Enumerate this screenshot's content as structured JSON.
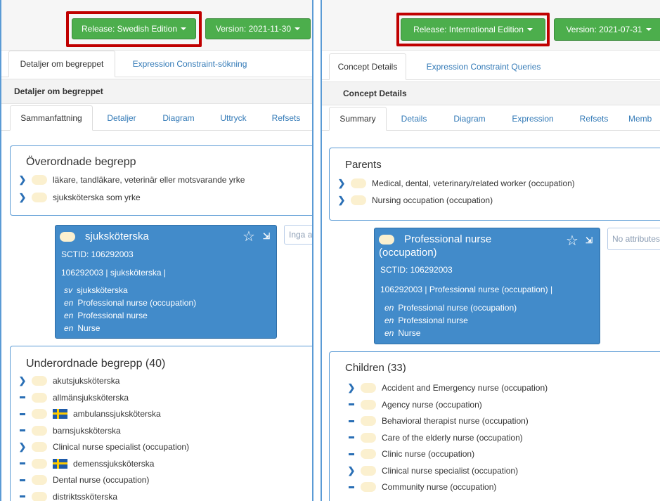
{
  "left": {
    "release_label": "Release: Swedish Edition",
    "version_label": "Version: 2021-11-30",
    "tabs": [
      "Detaljer om begreppet",
      "Expression Constraint-sökning"
    ],
    "section_title": "Detaljer om begreppet",
    "subtabs": [
      "Sammanfattning",
      "Detaljer",
      "Diagram",
      "Uttryck",
      "Refsets"
    ],
    "parents": {
      "title": "Överordnade begrepp",
      "items": [
        "läkare, tandläkare, veterinär eller motsvarande yrke",
        "sjuksköterska som yrke"
      ]
    },
    "concept": {
      "title": "sjuksköterska",
      "sctid": "SCTID: 106292003",
      "fsn": "106292003 | sjuksköterska |",
      "synonyms": [
        {
          "lang": "sv",
          "term": "sjuksköterska"
        },
        {
          "lang": "en",
          "term": "Professional nurse (occupation)"
        },
        {
          "lang": "en",
          "term": "Professional nurse"
        },
        {
          "lang": "en",
          "term": "Nurse"
        }
      ],
      "attributes": "Inga a"
    },
    "children": {
      "title": "Underordnade begrepp (40)",
      "items": [
        {
          "label": "akutsjuksköterska",
          "icon": "chevron",
          "flag": false
        },
        {
          "label": "allmänsjuksköterska",
          "icon": "dash",
          "flag": false
        },
        {
          "label": "ambulanssjuksköterska",
          "icon": "dash",
          "flag": true
        },
        {
          "label": "barnsjuksköterska",
          "icon": "dash",
          "flag": false
        },
        {
          "label": "Clinical nurse specialist (occupation)",
          "icon": "chevron",
          "flag": false
        },
        {
          "label": "demenssjuksköterska",
          "icon": "dash",
          "flag": true
        },
        {
          "label": "Dental nurse (occupation)",
          "icon": "dash",
          "flag": false
        },
        {
          "label": "distriktssköterska",
          "icon": "dash",
          "flag": false
        }
      ]
    }
  },
  "right": {
    "release_label": "Release: International Edition",
    "version_label": "Version: 2021-07-31",
    "tabs": [
      "Concept Details",
      "Expression Constraint Queries"
    ],
    "section_title": "Concept Details",
    "subtabs": [
      "Summary",
      "Details",
      "Diagram",
      "Expression",
      "Refsets",
      "Memb"
    ],
    "parents": {
      "title": "Parents",
      "items": [
        "Medical, dental, veterinary/related worker (occupation)",
        "Nursing occupation (occupation)"
      ]
    },
    "concept": {
      "title_line1": "Professional nurse",
      "title_line2": "(occupation)",
      "sctid": "SCTID: 106292003",
      "fsn": "106292003 | Professional nurse (occupation) |",
      "synonyms": [
        {
          "lang": "en",
          "term": "Professional nurse (occupation)"
        },
        {
          "lang": "en",
          "term": "Professional nurse"
        },
        {
          "lang": "en",
          "term": "Nurse"
        }
      ],
      "attributes": "No attributes"
    },
    "children": {
      "title": "Children (33)",
      "items": [
        {
          "label": "Accident and Emergency nurse (occupation)",
          "icon": "chevron"
        },
        {
          "label": "Agency nurse (occupation)",
          "icon": "dash"
        },
        {
          "label": "Behavioral therapist nurse (occupation)",
          "icon": "dash"
        },
        {
          "label": "Care of the elderly nurse (occupation)",
          "icon": "dash"
        },
        {
          "label": "Clinic nurse (occupation)",
          "icon": "dash"
        },
        {
          "label": "Clinical nurse specialist (occupation)",
          "icon": "chevron"
        },
        {
          "label": "Community nurse (occupation)",
          "icon": "dash"
        }
      ]
    }
  },
  "colors": {
    "green_button": "#4cae4c",
    "highlight": "#c00000",
    "concept_card": "#428bca",
    "panel_border": "#5b9bd5",
    "link": "#337ab7"
  }
}
